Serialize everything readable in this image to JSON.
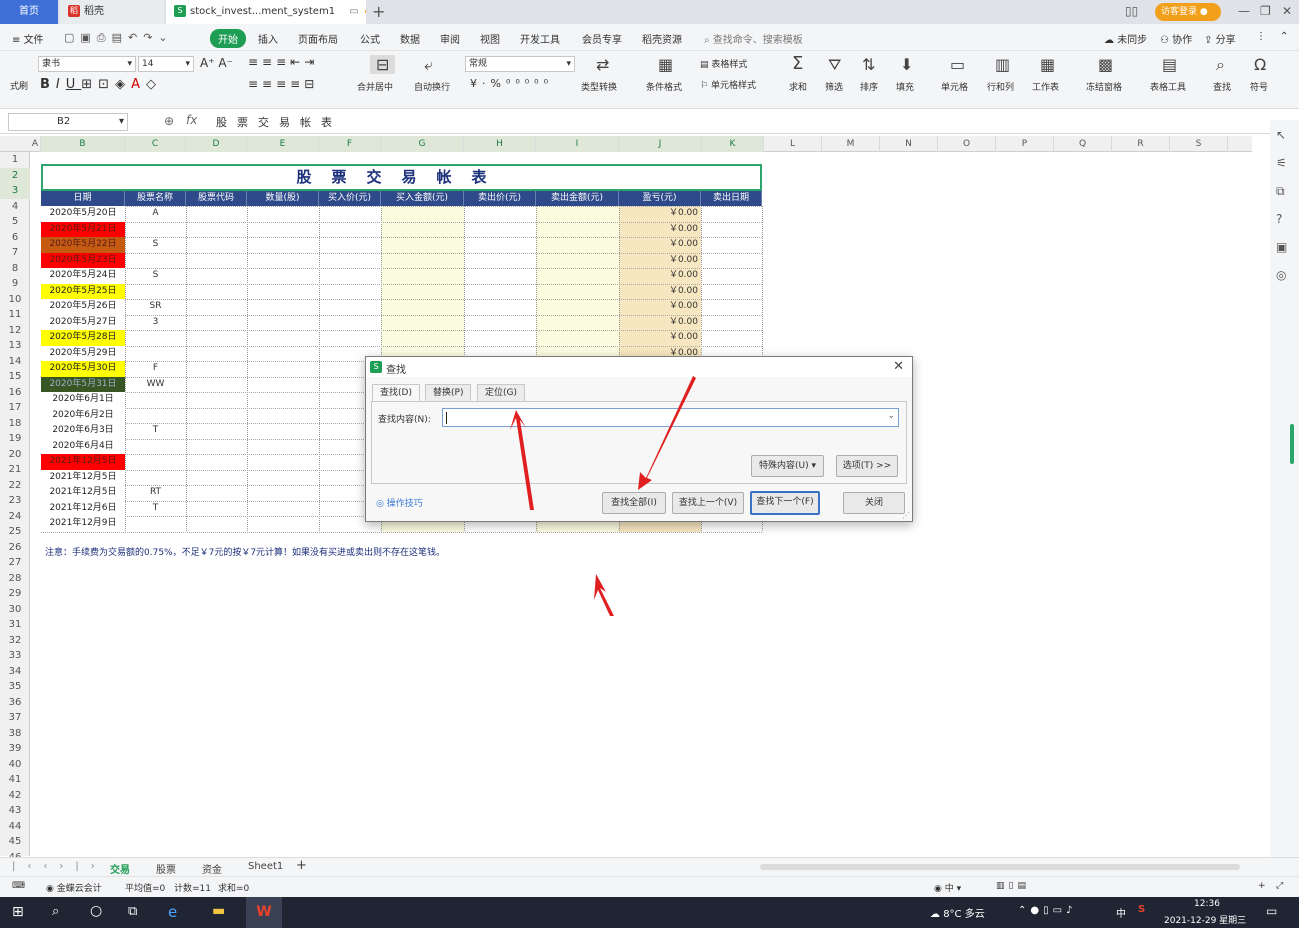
{
  "tabs": {
    "home": "首页",
    "daoke": "稻壳",
    "file": "stock_invest...ment_system1",
    "login": "访客登录"
  },
  "menu": {
    "file": "文件",
    "start": "开始",
    "insert": "插入",
    "layout": "页面布局",
    "formula": "公式",
    "data": "数据",
    "review": "审阅",
    "view": "视图",
    "dev": "开发工具",
    "member": "会员专享",
    "daoke_res": "稻壳资源",
    "search": "查找命令、搜索模板",
    "sync": "未同步",
    "collab": "协作",
    "share": "分享"
  },
  "ribbon": {
    "font": "隶书",
    "size": "14",
    "format": "常规",
    "merge": "合并居中",
    "wrap": "自动换行",
    "convert": "类型转换",
    "cond": "条件格式",
    "table_style": "表格样式",
    "cell_style": "单元格样式",
    "sum": "求和",
    "filter": "筛选",
    "sort": "排序",
    "fill": "填充",
    "cell": "单元格",
    "rowcol": "行和列",
    "sheet": "工作表",
    "freeze": "冻结窗格",
    "tools": "表格工具",
    "find": "查找",
    "symbol": "符号",
    "brush": "式刷"
  },
  "formula_bar": {
    "cell_ref": "B2",
    "fx": "fx",
    "content": "股票交易帐表"
  },
  "columns": [
    "A",
    "B",
    "C",
    "D",
    "E",
    "F",
    "G",
    "H",
    "I",
    "J",
    "K",
    "L",
    "M",
    "N",
    "O",
    "P",
    "Q",
    "R",
    "S"
  ],
  "rows": [
    "1",
    "2",
    "3",
    "4",
    "5",
    "6",
    "7",
    "8",
    "9",
    "10",
    "11",
    "12",
    "13",
    "14",
    "15",
    "16",
    "17",
    "18",
    "19",
    "20",
    "21",
    "22",
    "23",
    "24",
    "25",
    "26",
    "27",
    "28",
    "29",
    "30",
    "31",
    "32",
    "33",
    "34",
    "35",
    "36",
    "37",
    "38",
    "39",
    "40",
    "41",
    "42",
    "43",
    "44",
    "45",
    "46"
  ],
  "table": {
    "title": "股票交易帐表",
    "headers": [
      "日期",
      "股票名称",
      "股票代码",
      "数量(股)",
      "买入价(元)",
      "买入金额(元)",
      "卖出价(元)",
      "卖出金额(元)",
      "盈亏(元)",
      "卖出日期"
    ],
    "dates": [
      "2020年5月20日",
      "2020年5月21日",
      "2020年5月22日",
      "2020年5月23日",
      "2020年5月24日",
      "2020年5月25日",
      "2020年5月26日",
      "2020年5月27日",
      "2020年5月28日",
      "2020年5月29日",
      "2020年5月30日",
      "2020年5月31日",
      "2020年6月1日",
      "2020年6月2日",
      "2020年6月3日",
      "2020年6月4日",
      "2021年12月5日",
      "2021年12月5日",
      "2021年12月5日",
      "2021年12月6日",
      "2021年12月9日"
    ],
    "date_colors": [
      "#ffffff",
      "#ff0000",
      "#c55a11",
      "#ff0000",
      "#ffffff",
      "#ffff00",
      "#ffffff",
      "#ffffff",
      "#ffff00",
      "#ffffff",
      "#ffff00",
      "#375623",
      "#ffffff",
      "#ffffff",
      "#ffffff",
      "#ffffff",
      "#ff0000",
      "#ffffff",
      "#ffffff",
      "#ffffff",
      "#ffffff"
    ],
    "names": [
      "A",
      "",
      "S",
      "",
      "S",
      "",
      "SR",
      "3",
      "",
      "",
      "F",
      "WW",
      "",
      "",
      "T",
      "",
      "",
      "",
      "RT",
      "T",
      ""
    ],
    "profit": "￥0.00",
    "note": "注意：手续费为交易额的0.75%，不足￥7元的按￥7元计算！如果没有买进或卖出则不存在这笔钱。"
  },
  "dialog": {
    "title": "查找",
    "tab_find": "查找(D)",
    "tab_replace": "替换(P)",
    "tab_goto": "定位(G)",
    "label": "查找内容(N):",
    "value": "",
    "special": "特殊内容(U) ▾",
    "options": "选项(T) >>",
    "tips": "操作技巧",
    "find_all": "查找全部(I)",
    "find_prev": "查找上一个(V)",
    "find_next": "查找下一个(F)",
    "close": "关闭"
  },
  "sheet_tabs": [
    "交易",
    "股票",
    "资金",
    "Sheet1"
  ],
  "status": {
    "cloud": "金蝶云会计",
    "avg": "平均值=0",
    "count": "计数=11",
    "sum": "求和=0"
  },
  "taskbar": {
    "weather": "8°C 多云",
    "ime": "中",
    "time": "12:36",
    "date": "2021-12-29 星期三"
  }
}
